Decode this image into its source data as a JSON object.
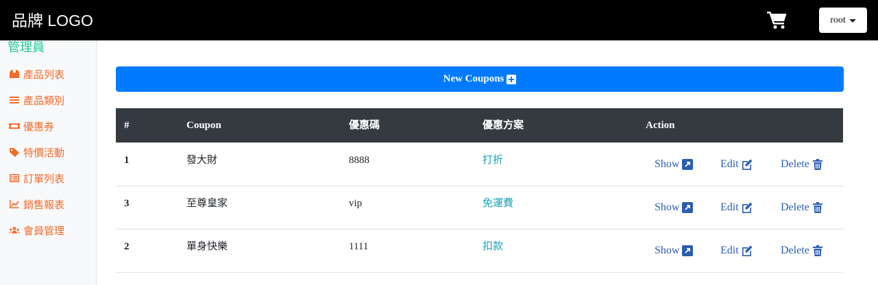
{
  "navbar": {
    "brand": "品牌 LOGO",
    "user": "root",
    "cart_icon": "cart-icon"
  },
  "sidebar": {
    "title": "管理員",
    "items": [
      {
        "label": "產品列表",
        "icon": "boxes-icon"
      },
      {
        "label": "產品類別",
        "icon": "list-icon"
      },
      {
        "label": "優惠券",
        "icon": "ticket-icon"
      },
      {
        "label": "特價活動",
        "icon": "tags-icon"
      },
      {
        "label": "訂單列表",
        "icon": "list-alt-icon"
      },
      {
        "label": "銷售報表",
        "icon": "chart-line-icon"
      },
      {
        "label": "會員管理",
        "icon": "users-icon"
      }
    ]
  },
  "main": {
    "new_button": "New Coupons",
    "columns": [
      "#",
      "Coupon",
      "優惠碼",
      "優惠方案",
      "Action"
    ],
    "rows": [
      {
        "id": "1",
        "coupon": "發大財",
        "code": "8888",
        "plan": "打折"
      },
      {
        "id": "3",
        "coupon": "至尊皇家",
        "code": "vip",
        "plan": "免運費"
      },
      {
        "id": "2",
        "coupon": "單身快樂",
        "code": "1111",
        "plan": "扣款"
      }
    ],
    "actions": {
      "show": "Show",
      "edit": "Edit",
      "delete": "Delete"
    }
  },
  "colors": {
    "navbar": "#000000",
    "primary": "#007bff",
    "sidebar_accent": "#f26b2a",
    "title": "#20c997",
    "plan": "#17a2b8",
    "table_head": "#343a40"
  }
}
